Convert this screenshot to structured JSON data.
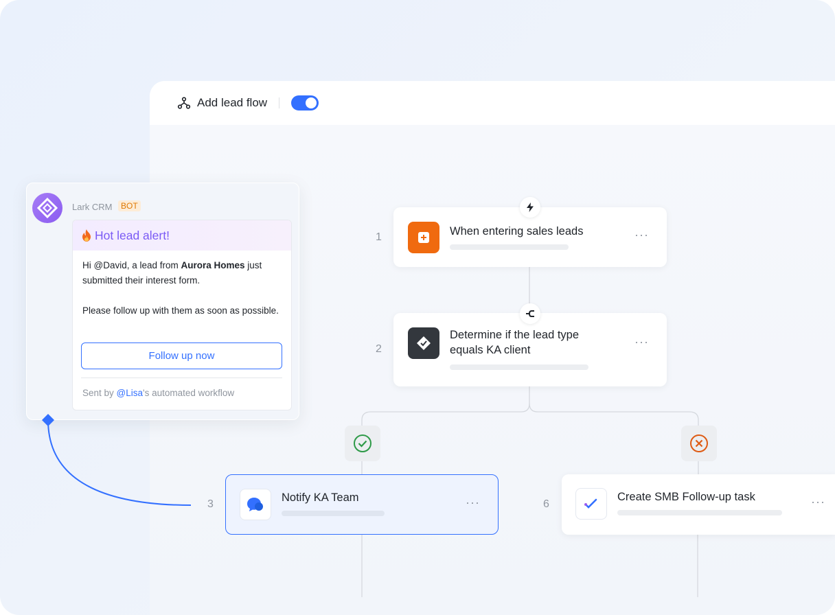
{
  "header": {
    "flow_title": "Add lead flow",
    "toggle_on": true,
    "icon": "workflow-icon"
  },
  "nodes": [
    {
      "step": "1",
      "title": "When entering sales leads",
      "icon": "plus-square-icon",
      "icon_color": "#f06a0f",
      "connector_icon": "lightning-icon"
    },
    {
      "step": "2",
      "title_line1": "Determine if the lead type",
      "title_line2": "equals KA client",
      "icon": "check-diamond-icon",
      "icon_color": "#33373d",
      "connector_icon": "branch-icon"
    },
    {
      "step": "3",
      "title": "Notify KA Team",
      "icon": "chat-bubbles-icon",
      "icon_color": "#3370ff",
      "branch": "check-circle-icon",
      "branch_color": "#2e9a48"
    },
    {
      "step": "6",
      "title": "Create SMB Follow-up task",
      "icon": "task-check-icon",
      "icon_color": "#3370ff",
      "branch": "x-circle-icon",
      "branch_color": "#de5b14"
    }
  ],
  "more_label": "···",
  "chat": {
    "sender": "Lark CRM",
    "badge": "BOT",
    "alert_title": "Hot lead alert!",
    "body_prefix": "Hi @David, a lead from ",
    "body_company": "Aurora Homes",
    "body_suffix": " just submitted their interest form.",
    "body_para2": "Please follow up with them as soon as possible.",
    "button_label": "Follow up now",
    "footer_prefix": "Sent by ",
    "footer_mention": "@Lisa",
    "footer_suffix": "'s automated workflow"
  },
  "colors": {
    "accent": "#3370ff",
    "bot_badge": "#de7802",
    "alert_title": "#7a5af5"
  }
}
